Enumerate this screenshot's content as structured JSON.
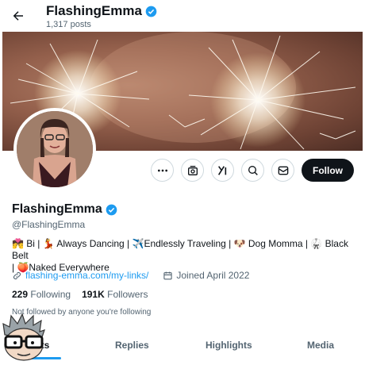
{
  "header": {
    "title": "FlashingEmma",
    "post_count": "1,317 posts"
  },
  "profile": {
    "display_name": "FlashingEmma",
    "handle": "@FlashingEmma",
    "bio_line1": "💏 Bi | 💃 Always Dancing | ✈️Endlessly Traveling | 🐶 Dog Momma | 🥋 Black Belt",
    "bio_line2": "| 🍑Naked Everywhere",
    "link": "flashing-emma.com/my-links/",
    "joined": "Joined April 2022",
    "following_count": "229",
    "following_label": "Following",
    "followers_count": "191K",
    "followers_label": "Followers",
    "followed_by": "Not followed by anyone you're following"
  },
  "actions": {
    "follow_label": "Follow",
    "icons": [
      "more-icon",
      "subscribe-icon",
      "grok-icon",
      "search-icon",
      "message-icon"
    ]
  },
  "tabs": [
    {
      "label": "Posts",
      "visible_text": "sts"
    },
    {
      "label": "Replies"
    },
    {
      "label": "Highlights"
    },
    {
      "label": "Media"
    }
  ],
  "colors": {
    "accent": "#1d9bf0",
    "text": "#0f1419",
    "secondary": "#536471",
    "follow_bg": "#0f1419"
  }
}
